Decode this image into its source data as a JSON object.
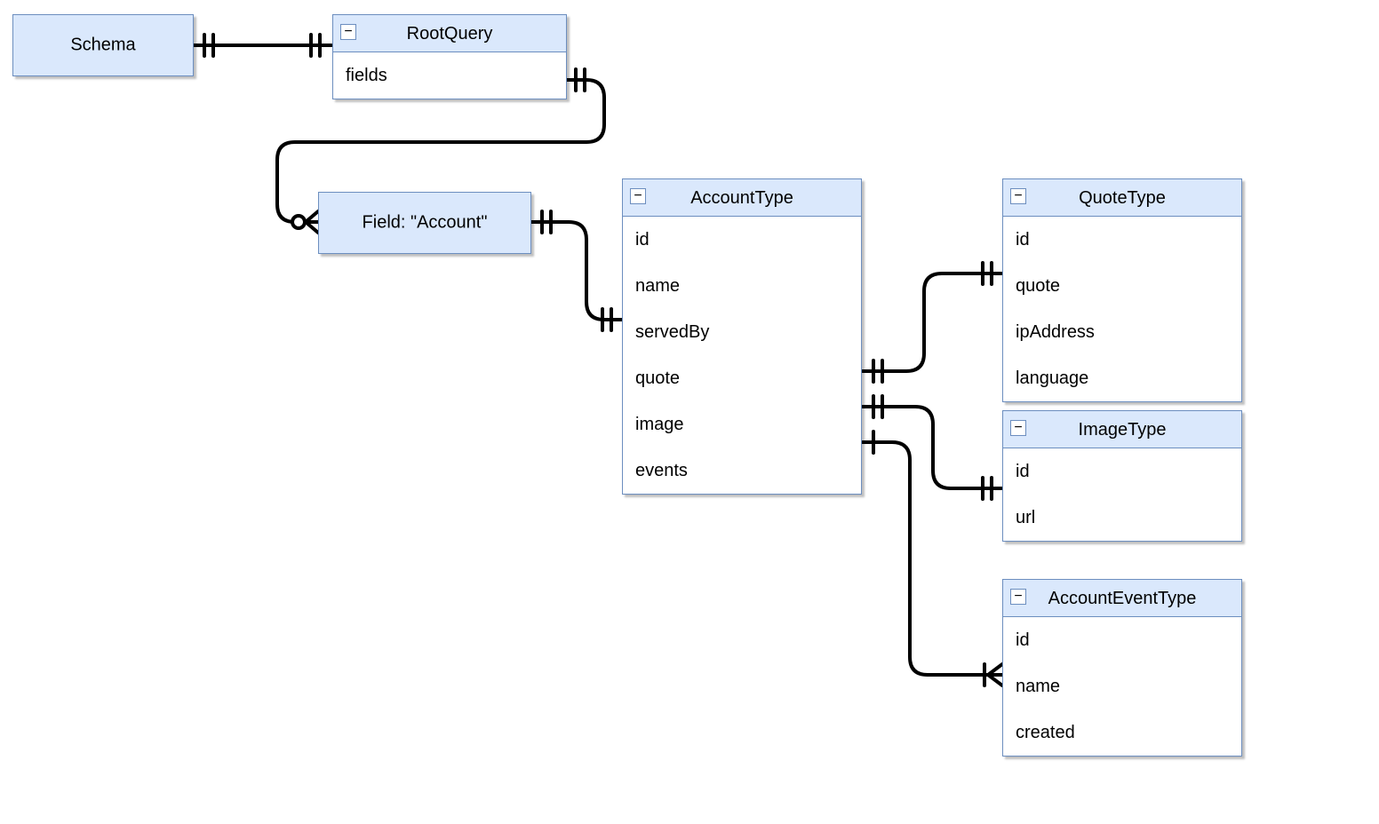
{
  "nodes": {
    "schema": {
      "title": "Schema"
    },
    "rootQuery": {
      "title": "RootQuery",
      "fields": [
        "fields"
      ]
    },
    "fieldAccount": {
      "title": "Field: \"Account\""
    },
    "accountType": {
      "title": "AccountType",
      "fields": [
        "id",
        "name",
        "servedBy",
        "quote",
        "image",
        "events"
      ]
    },
    "quoteType": {
      "title": "QuoteType",
      "fields": [
        "id",
        "quote",
        "ipAddress",
        "language"
      ]
    },
    "imageType": {
      "title": "ImageType",
      "fields": [
        "id",
        "url"
      ]
    },
    "accountEventType": {
      "title": "AccountEventType",
      "fields": [
        "id",
        "name",
        "created"
      ]
    }
  },
  "collapse_glyph": "−"
}
